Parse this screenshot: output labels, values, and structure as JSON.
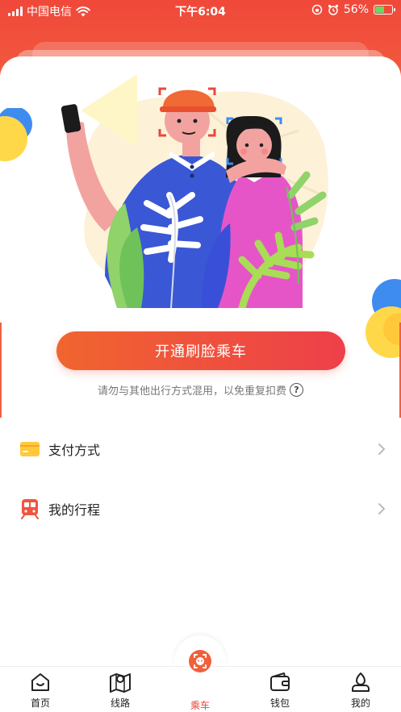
{
  "status_bar": {
    "carrier": "中国电信",
    "time": "下午6:04",
    "battery": "56%",
    "battery_level": 0.56
  },
  "main": {
    "open_button_label": "开通刷脸乘车",
    "hint_text": "请勿与其他出行方式混用，以免重复扣费",
    "help_icon_glyph": "?"
  },
  "menu": {
    "items": [
      {
        "label": "支付方式",
        "icon": "card-icon"
      },
      {
        "label": "我的行程",
        "icon": "train-icon"
      }
    ]
  },
  "tabbar": {
    "items": [
      {
        "label": "首页",
        "icon": "home-icon"
      },
      {
        "label": "线路",
        "icon": "map-route-icon"
      },
      {
        "label": "乘车",
        "icon": "face-scan-icon",
        "active": true
      },
      {
        "label": "钱包",
        "icon": "wallet-icon"
      },
      {
        "label": "我的",
        "icon": "profile-icon"
      }
    ]
  },
  "colors": {
    "brand": "#f0483a",
    "button_start": "#f0652f",
    "button_end": "#ee3f4a",
    "active_tab": "#e8483b"
  }
}
